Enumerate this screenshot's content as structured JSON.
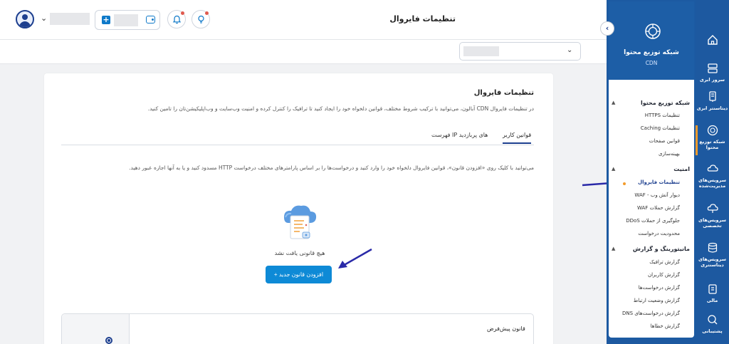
{
  "header": {
    "page_title": "تنظیمات فایروال",
    "icons": [
      "user-avatar",
      "chevron-down",
      "plus-square",
      "wallet",
      "bell",
      "lightbulb"
    ]
  },
  "card": {
    "title": "تنظیمات فایروال",
    "description": "در تنظیمات فایروال CDN آبالون، می‌توانید با ترکیب شروط مختلف، قوانین دلخواه خود را ایجاد کنید تا ترافیک را کنترل کرده و امنیت وب‌سایت و وب‌اپلیکیشن‌تان را تامین کنید.",
    "tabs": [
      {
        "label": "قوانین کاربر",
        "active": true
      },
      {
        "label": "فهرست IP های پربازدید",
        "active": false
      }
    ],
    "rules_description": "می‌توانید با کلیک روی «افزودن قانون»، قوانین فایروال دلخواه خود را وارد کنید و درخواست‌ها را بر اساس پارامترهای مختلف درخواست HTTP مسدود کنید و یا به آنها اجازه عبور دهید.",
    "empty_text": "هیچ قانونی یافت نشد",
    "add_button": "+ افزودن قانون جدید",
    "default_rule_title": "قانون پیش‌فرض"
  },
  "sidebar": {
    "service_title": "شبکه توزیع محتوا",
    "service_sub": "CDN",
    "sections": [
      {
        "title": "شبکه توزیع محتوا",
        "items": [
          "تنظیمات HTTPS",
          "تنظیمات Caching",
          "قوانین صفحات",
          "بهینه‌سازی"
        ]
      },
      {
        "title": "امنیت",
        "items": [
          "تنظیمات فایروال",
          "دیوار آتش وب - WAF",
          "گزارش حملات WAF",
          "جلوگیری از حملات DDoS",
          "محدودیت درخواست"
        ]
      },
      {
        "title": "مانیتورینگ و گزارش",
        "items": [
          "گزارش ترافیک",
          "گزارش کاربران",
          "گزارش درخواست‌ها",
          "گزارش وضعیت ارتباط",
          "گزارش درخواست‌های DNS",
          "گزارش خطاها"
        ]
      }
    ],
    "active_item": "تنظیمات فایروال"
  },
  "rail": {
    "items": [
      "",
      "سرور ابری",
      "دیتاسنتر ابری",
      "شبکه توزیع محتوا",
      "سرویس‌های مدیریت‌شده",
      "سرویس‌های تخصصی",
      "سرویس‌های دیتاسنتری",
      "مالی",
      "پشتیبانی"
    ]
  },
  "colors": {
    "primary": "#1d59a0",
    "button": "#0e8ad6",
    "accent": "#f29b2b",
    "annotation_arrow": "#2a2aa8"
  }
}
